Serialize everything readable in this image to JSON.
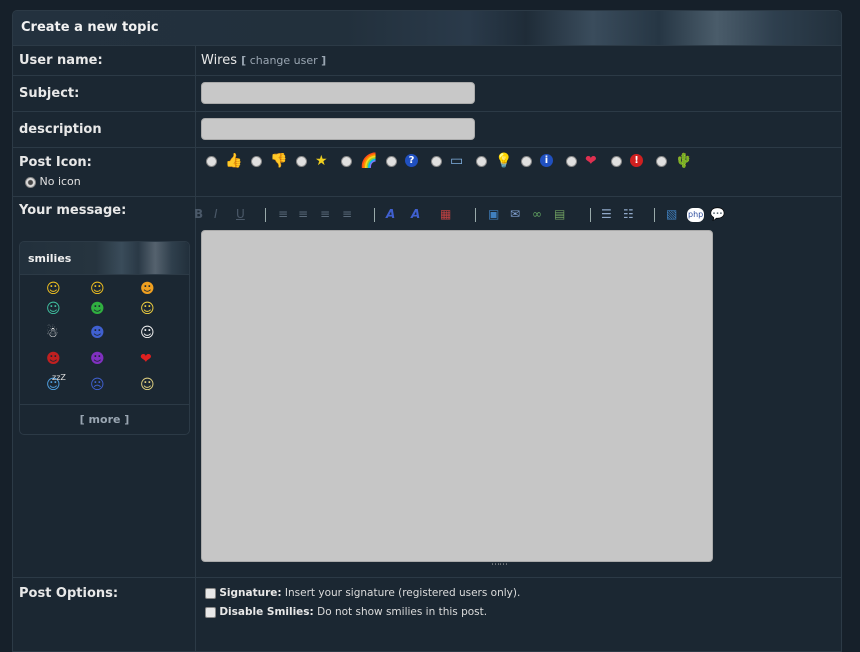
{
  "panel": {
    "title": "Create a new topic"
  },
  "labels": {
    "username": "User name:",
    "subject": "Subject:",
    "description": "description",
    "post_icon": "Post Icon:",
    "no_icon": "No icon",
    "message": "Your message:",
    "post_options": "Post Options:"
  },
  "user": {
    "name": "Wires",
    "change_open": "[",
    "change_label": "change user",
    "change_close": "]"
  },
  "post_icons": [
    {
      "name": "thumbs-up-icon",
      "glyph": "👍",
      "color": "#e0a040"
    },
    {
      "name": "thumbs-down-icon",
      "glyph": "👎",
      "color": "#e0a040"
    },
    {
      "name": "star-icon",
      "glyph": "★",
      "color": "#f0d020"
    },
    {
      "name": "rainbow-icon",
      "glyph": "🌈",
      "color": "#e06040"
    },
    {
      "name": "question-icon",
      "glyph": "?",
      "color": "#ffffff"
    },
    {
      "name": "screen-icon",
      "glyph": "▭",
      "color": "#80b0e0"
    },
    {
      "name": "lightbulb-icon",
      "glyph": "💡",
      "color": "#f0e060"
    },
    {
      "name": "info-icon",
      "glyph": "i",
      "color": "#ffffff"
    },
    {
      "name": "heart-icon",
      "glyph": "❤",
      "color": "#e03050"
    },
    {
      "name": "exclamation-icon",
      "glyph": "!",
      "color": "#ffffff"
    },
    {
      "name": "cactus-icon",
      "glyph": "🌵",
      "color": "#40a040"
    }
  ],
  "toolbar": [
    "bold-icon",
    "italic-icon",
    "underline-icon",
    "align-left-icon",
    "align-center-icon",
    "align-right-icon",
    "justify-icon",
    "font-icon",
    "font-color-icon",
    "color-grid-icon",
    "insert-image-icon",
    "insert-email-icon",
    "insert-link-icon",
    "insert-table-icon",
    "bullet-list-icon",
    "numbered-list-icon",
    "code-icon",
    "php-icon",
    "quote-icon"
  ],
  "toolbar_text": {
    "bold": "B",
    "italic": "I",
    "underline": "U",
    "font": "A",
    "font_color": "A",
    "php": "php"
  },
  "smilies": {
    "title": "smilies",
    "items": [
      "smile-icon",
      "happy-icon",
      "cool-icon",
      "grin-icon",
      "green-face-icon",
      "nerd-icon",
      "snowman-icon",
      "blue-face-icon",
      "ghost-icon",
      "angry-icon",
      "devil-icon",
      "hearts-icon",
      "sleeping-icon",
      "sad-icon",
      "smoking-icon"
    ],
    "more_open": "[",
    "more_label": "more",
    "more_close": "]",
    "sleep_text": "zzZ"
  },
  "options": [
    {
      "bold": "Signature:",
      "text": "Insert your signature (registered users only)."
    },
    {
      "bold": "Disable Smilies:",
      "text": "Do not show smilies in this post."
    }
  ]
}
